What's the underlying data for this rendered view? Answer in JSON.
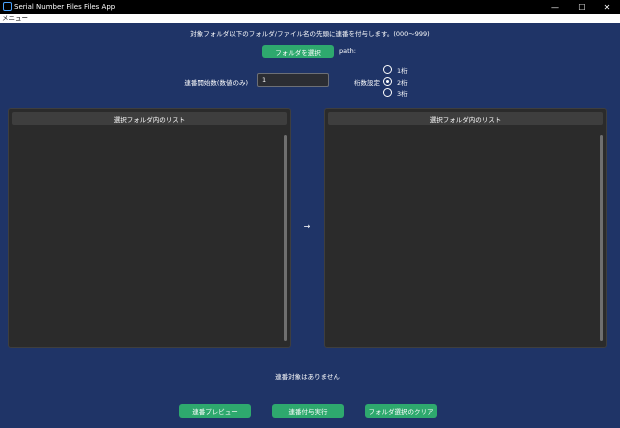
{
  "window": {
    "title": "Serial Number Files Files App",
    "minimize_glyph": "—",
    "maximize_glyph": "☐",
    "close_glyph": "✕"
  },
  "menu": {
    "label": "メニュー"
  },
  "instruction": "対象フォルダ以下のフォルダ/ファイル名の先頭に連番を付与します。(000〜999)",
  "folder_select": {
    "button_label": "フォルダを選択",
    "path_label": "path:"
  },
  "start_number": {
    "label": "連番開始数(数値のみ)",
    "value": "1"
  },
  "digits": {
    "label": "桁数設定",
    "options": [
      {
        "label": "1桁",
        "selected": false
      },
      {
        "label": "2桁",
        "selected": true
      },
      {
        "label": "3桁",
        "selected": false
      }
    ]
  },
  "left_panel": {
    "header": "選択フォルダ内のリスト"
  },
  "right_panel": {
    "header": "選択フォルダ内のリスト"
  },
  "arrow": "→",
  "status": "連番対象はありません",
  "buttons": {
    "preview": "連番プレビュー",
    "execute": "連番付与実行",
    "clear": "フォルダ選択のクリア"
  },
  "colors": {
    "background": "#1f3467",
    "button_green": "#2ea96e",
    "panel": "#2b2b2b",
    "panel_header": "#3e3e3e"
  }
}
